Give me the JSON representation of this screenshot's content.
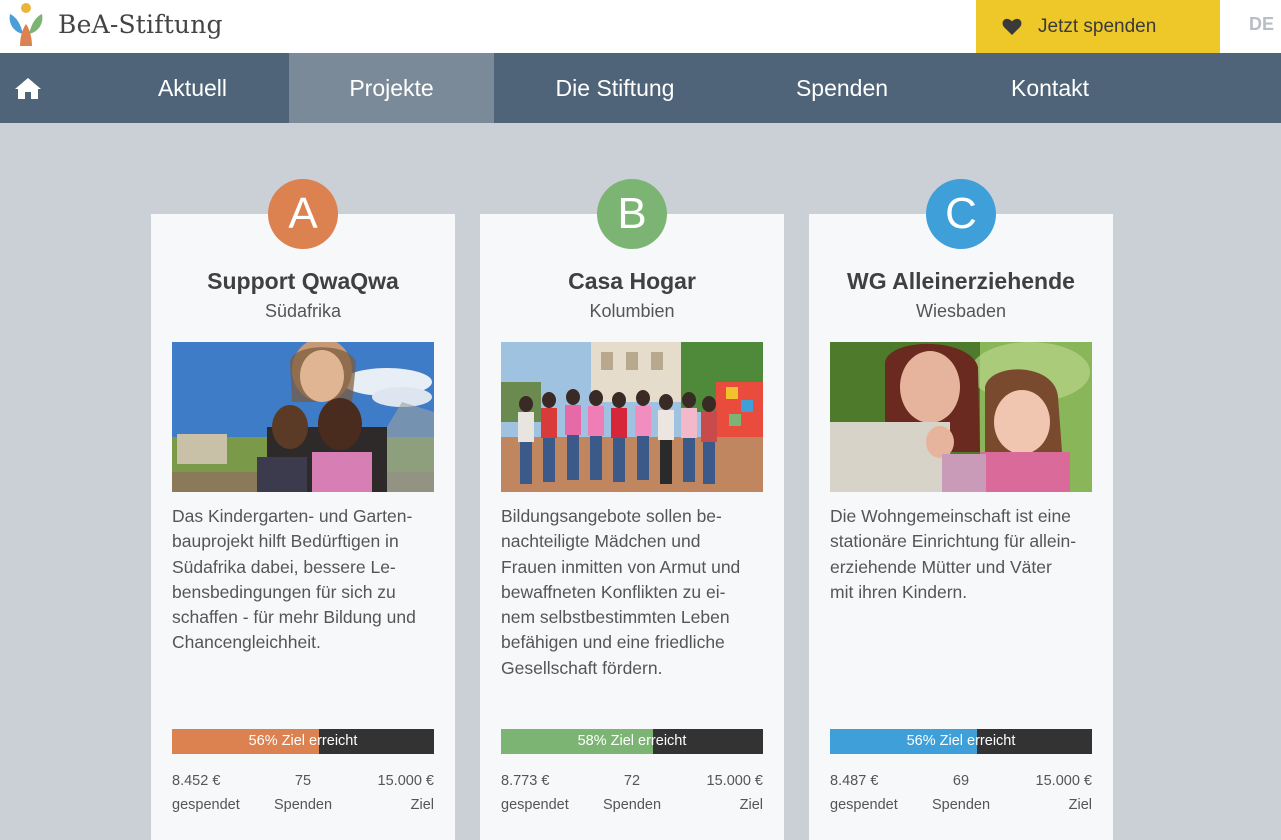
{
  "header": {
    "brand": "BeA-Stiftung",
    "donate_label": "Jetzt spenden",
    "language": "DE"
  },
  "nav": {
    "home_icon": "home-icon",
    "items": [
      {
        "label": "Aktuell",
        "active": false
      },
      {
        "label": "Projekte",
        "active": true
      },
      {
        "label": "Die Stiftung",
        "active": false
      },
      {
        "label": "Spenden",
        "active": false
      },
      {
        "label": "Kontakt",
        "active": false
      }
    ]
  },
  "colors": {
    "nav_bg": "#4f6478",
    "nav_active": "#7b8a99",
    "donate": "#eec728",
    "project_a": "#dc8150",
    "project_b": "#7cb473",
    "project_c": "#3f9fd8"
  },
  "projects": [
    {
      "letter": "A",
      "title": "Support QwaQwa",
      "location": "Südafrika",
      "description": [
        "Das Kindergarten- und Garten-",
        "bauprojekt hilft Bedürftigen in",
        "Südafrika dabei, bessere Le-",
        "bensbedingungen für sich zu",
        "schaffen - für mehr Bildung und",
        "Chancengleichheit."
      ],
      "progress_percent": 56,
      "progress_label": "56% Ziel erreicht",
      "donated": "8.452 €",
      "donated_label": "gespendet",
      "donations": "75",
      "donations_label": "Spenden",
      "goal": "15.000 €",
      "goal_label": "Ziel"
    },
    {
      "letter": "B",
      "title": "Casa Hogar",
      "location": "Kolumbien",
      "description": [
        "Bildungsangebote sollen be-",
        "nachteiligte Mädchen und",
        "Frauen inmitten von Armut und",
        "bewaffneten Konflikten zu ei-",
        "nem selbstbestimmten Leben",
        "befähigen und eine friedliche",
        "Gesellschaft fördern."
      ],
      "progress_percent": 58,
      "progress_label": "58% Ziel erreicht",
      "donated": "8.773 €",
      "donated_label": "gespendet",
      "donations": "72",
      "donations_label": "Spenden",
      "goal": "15.000 €",
      "goal_label": "Ziel"
    },
    {
      "letter": "C",
      "title": "WG Alleinerziehende",
      "location": "Wiesbaden",
      "description": [
        "Die Wohngemeinschaft ist eine",
        "stationäre Einrichtung für allein-",
        "erziehende Mütter und Väter",
        "mit ihren Kindern."
      ],
      "progress_percent": 56,
      "progress_label": "56% Ziel erreicht",
      "donated": "8.487 €",
      "donated_label": "gespendet",
      "donations": "69",
      "donations_label": "Spenden",
      "goal": "15.000 €",
      "goal_label": "Ziel"
    }
  ]
}
